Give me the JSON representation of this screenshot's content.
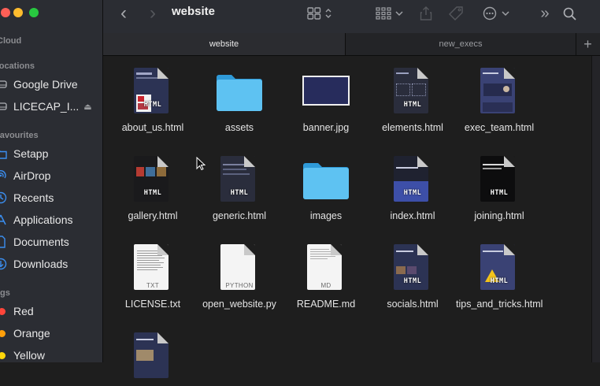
{
  "window": {
    "title": "website"
  },
  "sidebar": {
    "sections": [
      {
        "header": "iCloud"
      },
      {
        "header": "Locations",
        "items": [
          {
            "label": "Google Drive",
            "icon": "drive-icon"
          },
          {
            "label": "LICECAP_I...",
            "icon": "drive-icon"
          }
        ]
      },
      {
        "header": "Favourites",
        "items": [
          {
            "label": "Setapp",
            "icon": "folder-icon"
          },
          {
            "label": "AirDrop",
            "icon": "airdrop-icon"
          },
          {
            "label": "Recents",
            "icon": "clock-icon"
          },
          {
            "label": "Applications",
            "icon": "applications-icon"
          },
          {
            "label": "Documents",
            "icon": "document-icon"
          },
          {
            "label": "Downloads",
            "icon": "download-icon"
          }
        ]
      },
      {
        "header": "Tags",
        "items": [
          {
            "label": "Red",
            "color": "#ff453a"
          },
          {
            "label": "Orange",
            "color": "#ff9f0a"
          },
          {
            "label": "Yellow",
            "color": "#ffd60a"
          }
        ]
      }
    ]
  },
  "tabs": [
    {
      "label": "website",
      "active": true
    },
    {
      "label": "new_execs",
      "active": false
    }
  ],
  "files": [
    {
      "name": "about_us.html",
      "kind": "html"
    },
    {
      "name": "assets",
      "kind": "folder"
    },
    {
      "name": "banner.jpg",
      "kind": "image"
    },
    {
      "name": "elements.html",
      "kind": "html"
    },
    {
      "name": "exec_team.html",
      "kind": "html"
    },
    {
      "name": "gallery.html",
      "kind": "html"
    },
    {
      "name": "generic.html",
      "kind": "html"
    },
    {
      "name": "images",
      "kind": "folder"
    },
    {
      "name": "index.html",
      "kind": "html"
    },
    {
      "name": "joining.html",
      "kind": "html"
    },
    {
      "name": "LICENSE.txt",
      "kind": "txt"
    },
    {
      "name": "open_website.py",
      "kind": "py"
    },
    {
      "name": "README.md",
      "kind": "md"
    },
    {
      "name": "socials.html",
      "kind": "html"
    },
    {
      "name": "tips_and_tricks.html",
      "kind": "html"
    },
    {
      "name": "",
      "kind": "html"
    }
  ],
  "file_badges": {
    "html": "HTML",
    "txt": "TXT",
    "py": "PYTHON",
    "md": "MD"
  },
  "icons": {
    "back": "‹",
    "forward": "›",
    "more": "»"
  },
  "colors": {
    "folder": "#5ec2f2",
    "accent": "#2f7dd8",
    "sidebar_bg": "#2b2d33"
  }
}
